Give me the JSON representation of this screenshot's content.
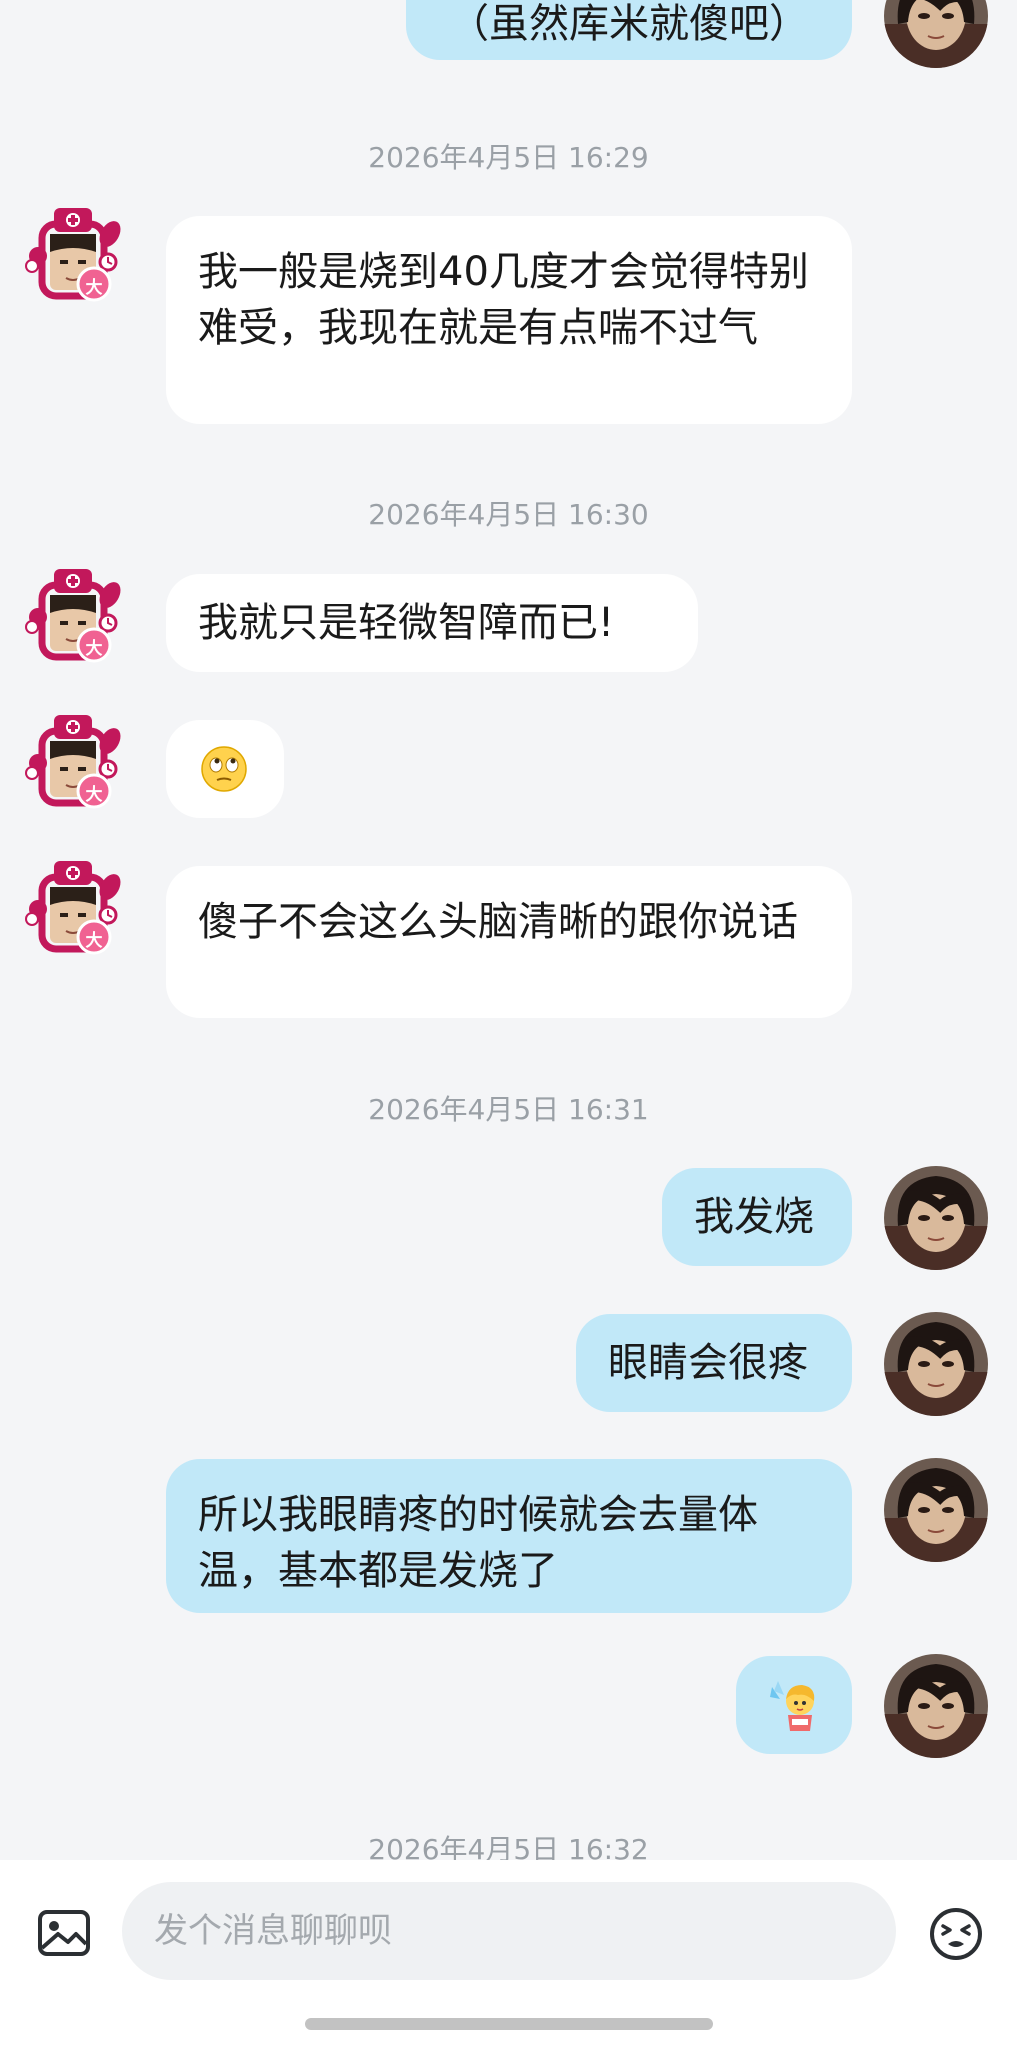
{
  "messages": {
    "m0": "（虽然库米就傻吧）",
    "t1": "2026年4月5日 16:29",
    "m1": "我一般是烧到40几度才会觉得特别难受，我现在就是有点喘不过气",
    "t2": "2026年4月5日 16:30",
    "m2": "我就只是轻微智障而已!",
    "m3_icon": "rolling-eyes-emoji",
    "m4": "傻子不会这么头脑清晰的跟你说话",
    "t3": "2026年4月5日 16:31",
    "m5": "我发烧",
    "m6": "眼睛会很疼",
    "m7": "所以我眼睛疼的时候就会去量体温，基本都是发烧了",
    "m8_icon": "cartoon-sticker",
    "t4": "2026年4月5日 16:32"
  },
  "input": {
    "placeholder": "发个消息聊聊呗"
  },
  "badge": {
    "label": "大"
  },
  "colors": {
    "background": "#f4f5f7",
    "incoming_bubble": "#ffffff",
    "outgoing_bubble": "#c1e8f8",
    "avatar_frame": "#c2185b",
    "timestamp": "#9aa0a6"
  }
}
